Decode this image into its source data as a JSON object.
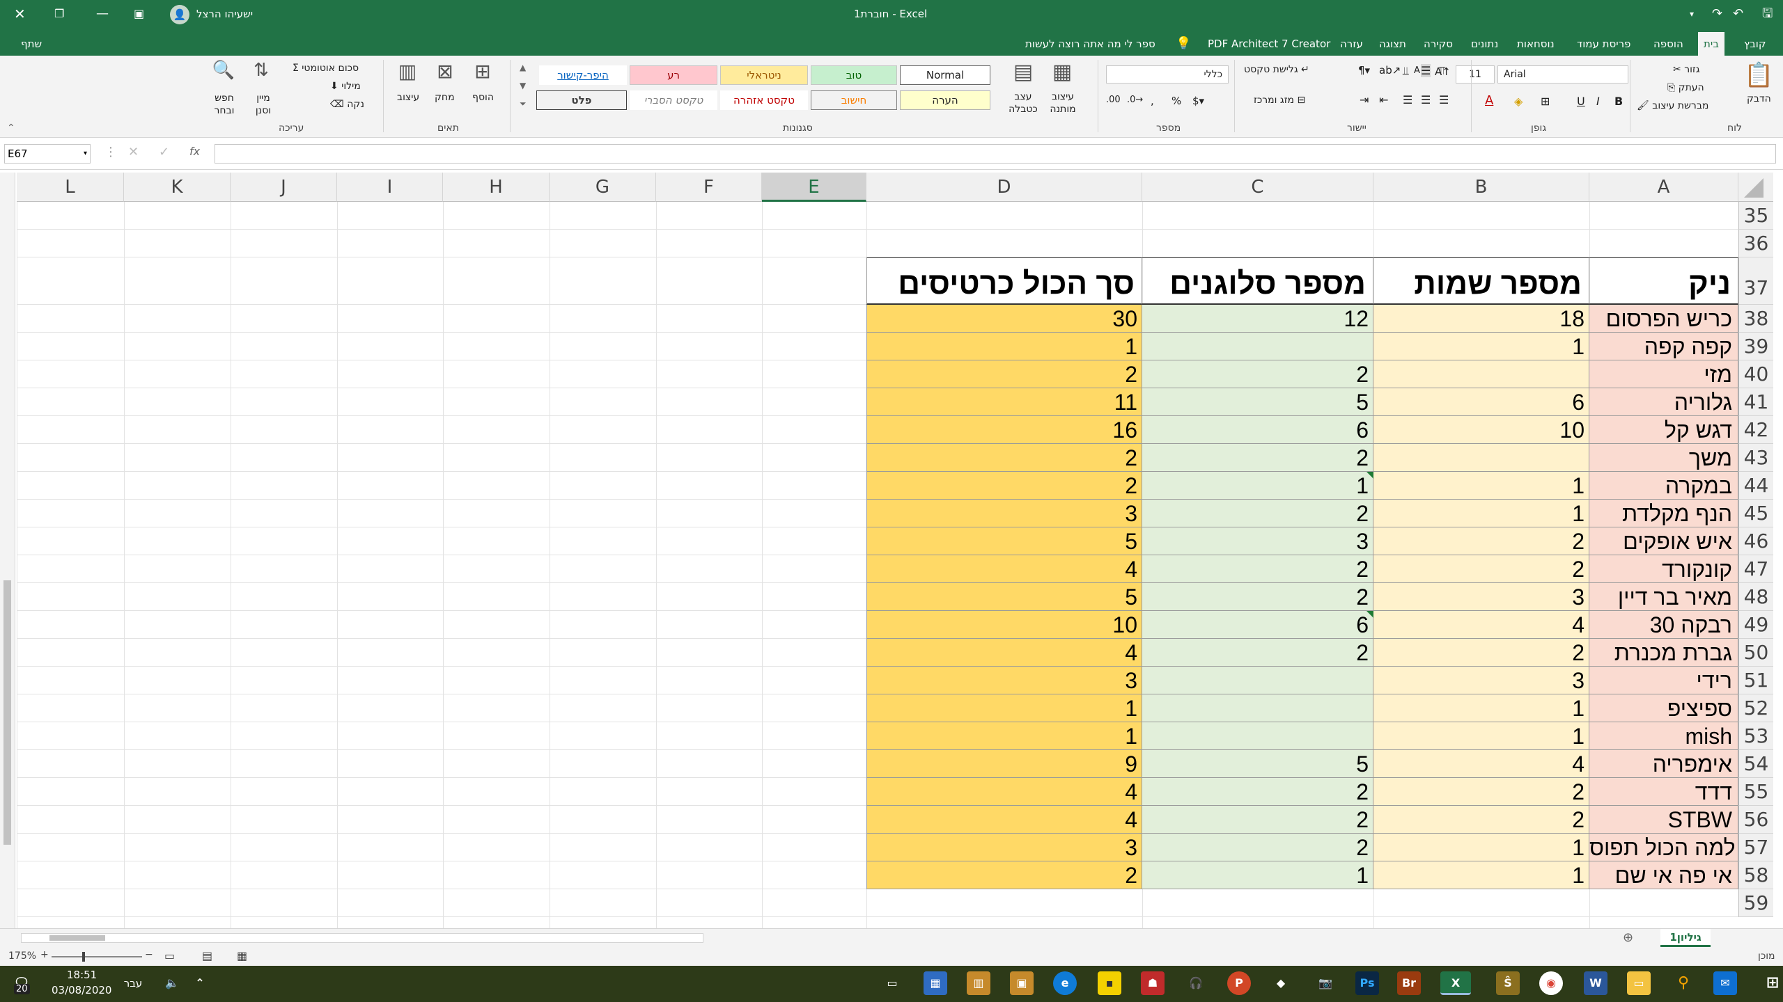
{
  "titlebar": {
    "title": "חוברת1 - Excel",
    "user": "ישעיהו הרצל"
  },
  "ribbon_tabs": [
    "קובץ",
    "בית",
    "הוספה",
    "פריסת עמוד",
    "נוסחאות",
    "נתונים",
    "סקירה",
    "תצוגה",
    "עזרה",
    "PDF Architect 7 Creator"
  ],
  "active_tab": "בית",
  "tell_me": "ספר לי מה אתה רוצה לעשות",
  "share": "שתף",
  "ribbon": {
    "clipboard": {
      "label": "לוח",
      "paste": "הדבק",
      "cut": "גזור",
      "copy": "העתק",
      "format_painter": "מברשת עיצוב"
    },
    "font": {
      "label": "גופן",
      "name": "Arial",
      "size": "11",
      "bold": "B",
      "italic": "I",
      "underline": "U"
    },
    "alignment": {
      "label": "יישור",
      "wrap": "גלישת טקסט",
      "merge": "מזג ומרכז"
    },
    "number": {
      "label": "מספר",
      "format": "כללי"
    },
    "styles": {
      "label": "סגנונות",
      "conditional": "עיצוב מותנה",
      "as_table": "עצב כטבלה",
      "normal": "Normal",
      "good": "טוב",
      "neutral": "ניטראלי",
      "bad": "רע",
      "hyperlink": "היפר-קישור",
      "note": "הערה",
      "calculation": "חישוב",
      "warning": "טקסט אזהרה",
      "explanatory": "טקסט הסברי",
      "output": "פלט"
    },
    "cells": {
      "label": "תאים",
      "insert": "הוסף",
      "delete": "מחק",
      "format": "עיצוב"
    },
    "editing": {
      "label": "עריכה",
      "autosum": "סכום אוטומטי",
      "fill": "מילוי",
      "clear": "נקה",
      "sort": "מיין וסנן",
      "find": "חפש ובחר"
    }
  },
  "formula_bar": {
    "name_box": "E67",
    "fx": "fx",
    "content": ""
  },
  "columns": [
    "A",
    "B",
    "C",
    "D",
    "E",
    "F",
    "G",
    "H",
    "I",
    "J",
    "K",
    "L"
  ],
  "selected_column": "E",
  "rows": [
    35,
    36,
    37,
    38,
    39,
    40,
    41,
    42,
    43,
    44,
    45,
    46,
    47,
    48,
    49,
    50,
    51,
    52,
    53,
    54,
    55,
    56,
    57,
    58,
    59
  ],
  "table": {
    "headers": [
      "ניק",
      "מספר שמות",
      "מספר סלוגנים",
      "סך הכול כרטיסים"
    ],
    "data": [
      [
        "כריש הפרסום",
        "18",
        "12",
        "30"
      ],
      [
        "קפה קפה",
        "1",
        "",
        "1"
      ],
      [
        "מזי",
        "",
        "2",
        "2"
      ],
      [
        "גלוריה",
        "6",
        "5",
        "11"
      ],
      [
        "דגש קל",
        "10",
        "6",
        "16"
      ],
      [
        "משך",
        "",
        "2",
        "2"
      ],
      [
        "במקרה",
        "1",
        "1",
        "2"
      ],
      [
        "הנף מקלדת",
        "1",
        "2",
        "3"
      ],
      [
        "איש אופקים",
        "2",
        "3",
        "5"
      ],
      [
        "קונקורד",
        "2",
        "2",
        "4"
      ],
      [
        "מאיר בר דיין",
        "3",
        "2",
        "5"
      ],
      [
        "רבקה 30",
        "4",
        "6",
        "10"
      ],
      [
        "גברת מכנרת",
        "2",
        "2",
        "4"
      ],
      [
        "רידי",
        "3",
        "",
        "3"
      ],
      [
        "ספיציפ",
        "1",
        "",
        "1"
      ],
      [
        "mish",
        "1",
        "",
        "1"
      ],
      [
        "אימפריה",
        "4",
        "5",
        "9"
      ],
      [
        "דדד",
        "2",
        "2",
        "4"
      ],
      [
        "STBW",
        "2",
        "2",
        "4"
      ],
      [
        "למה הכול תפוס",
        "1",
        "2",
        "3"
      ],
      [
        "אי פה אי שם",
        "1",
        "1",
        "2"
      ]
    ]
  },
  "sheet_tab": "גיליון1",
  "status": {
    "ready": "מוכן",
    "zoom": "175%"
  },
  "taskbar": {
    "time": "18:51",
    "date": "03/08/2020",
    "lang": "עבר",
    "notif": "20"
  }
}
